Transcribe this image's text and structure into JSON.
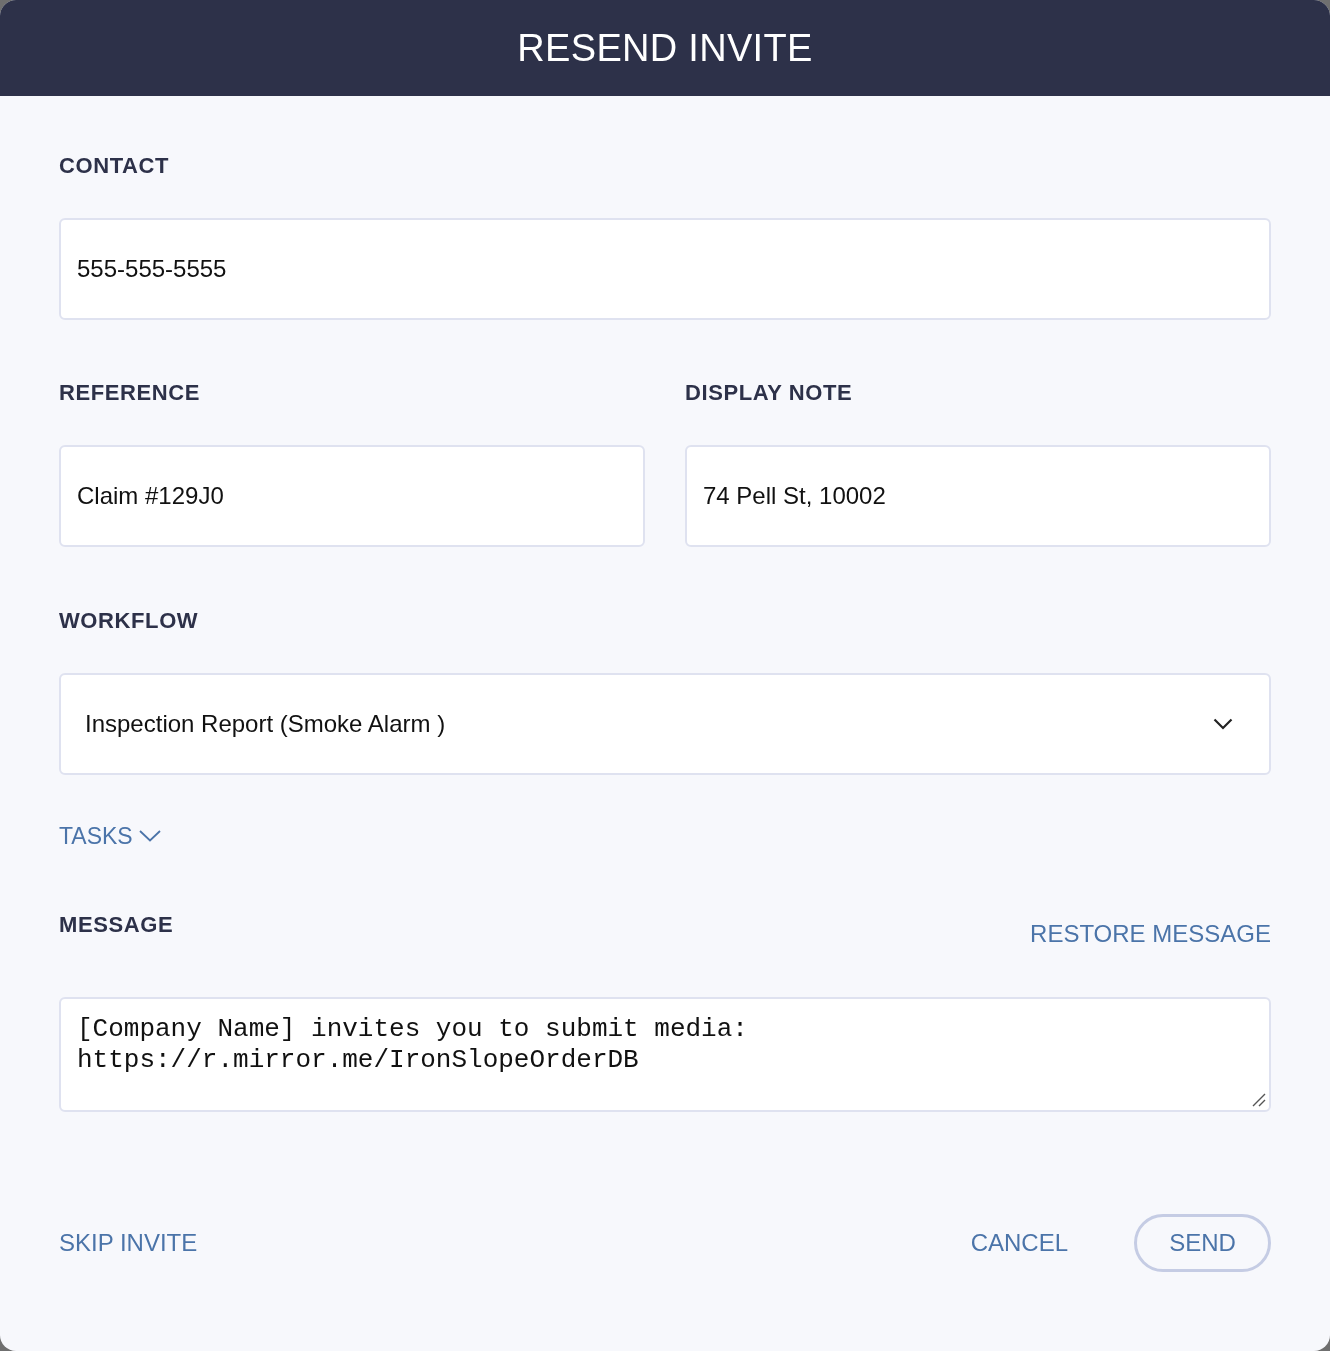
{
  "dialog": {
    "title": "RESEND INVITE"
  },
  "contact": {
    "label": "CONTACT",
    "value": "555-555-5555"
  },
  "reference": {
    "label": "REFERENCE",
    "value": "Claim #129J0"
  },
  "display_note": {
    "label": "DISPLAY NOTE",
    "value": "74 Pell St, 10002"
  },
  "workflow": {
    "label": "WORKFLOW",
    "value": "Inspection Report (Smoke Alarm )"
  },
  "tasks": {
    "label": "TASKS",
    "expanded": false
  },
  "message": {
    "label": "MESSAGE",
    "restore": "RESTORE MESSAGE",
    "value": "[Company Name] invites you to submit media:\nhttps://r.mirror.me/IronSlopeOrderDB"
  },
  "footer": {
    "skip": "SKIP INVITE",
    "cancel": "CANCEL",
    "send": "SEND"
  }
}
